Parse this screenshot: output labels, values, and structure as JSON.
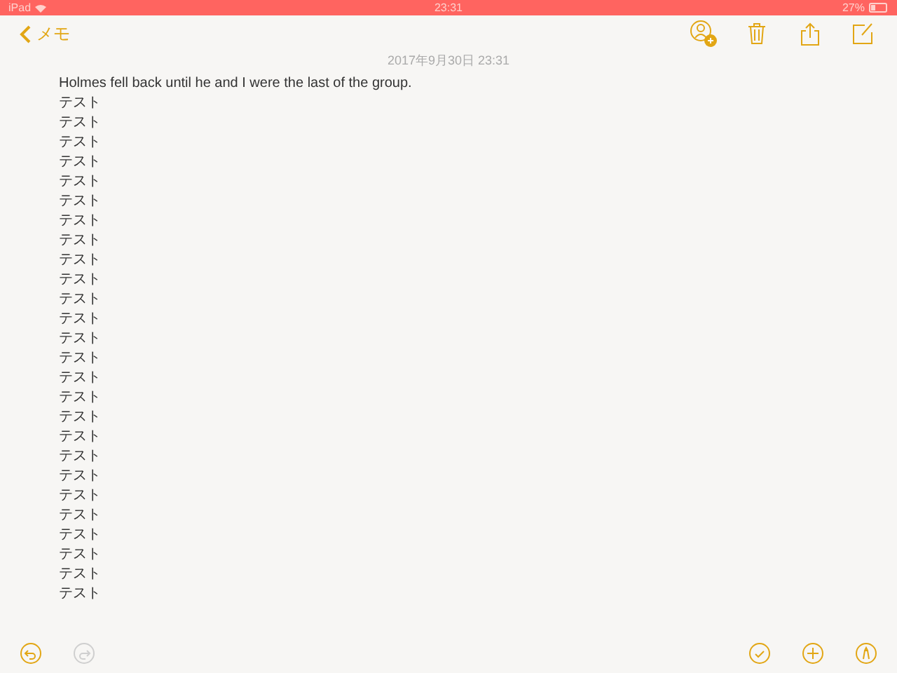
{
  "status_bar": {
    "device": "iPad",
    "time": "23:31",
    "battery": "27%"
  },
  "nav": {
    "back_label": "メモ"
  },
  "note": {
    "date": "2017年9月30日 23:31",
    "lines": [
      "Holmes fell back until he and I were the last of the group.",
      "テスト",
      "テスト",
      "テスト",
      "テスト",
      "テスト",
      "テスト",
      "テスト",
      "テスト",
      "テスト",
      "テスト",
      "テスト",
      "テスト",
      "テスト",
      "テスト",
      "テスト",
      "テスト",
      "テスト",
      "テスト",
      "テスト",
      "テスト",
      "テスト",
      "テスト",
      "テスト",
      "テスト",
      "テスト",
      "テスト"
    ]
  },
  "bottom_toolbar": {
    "undo": {
      "disabled": false
    },
    "redo": {
      "disabled": true
    }
  }
}
